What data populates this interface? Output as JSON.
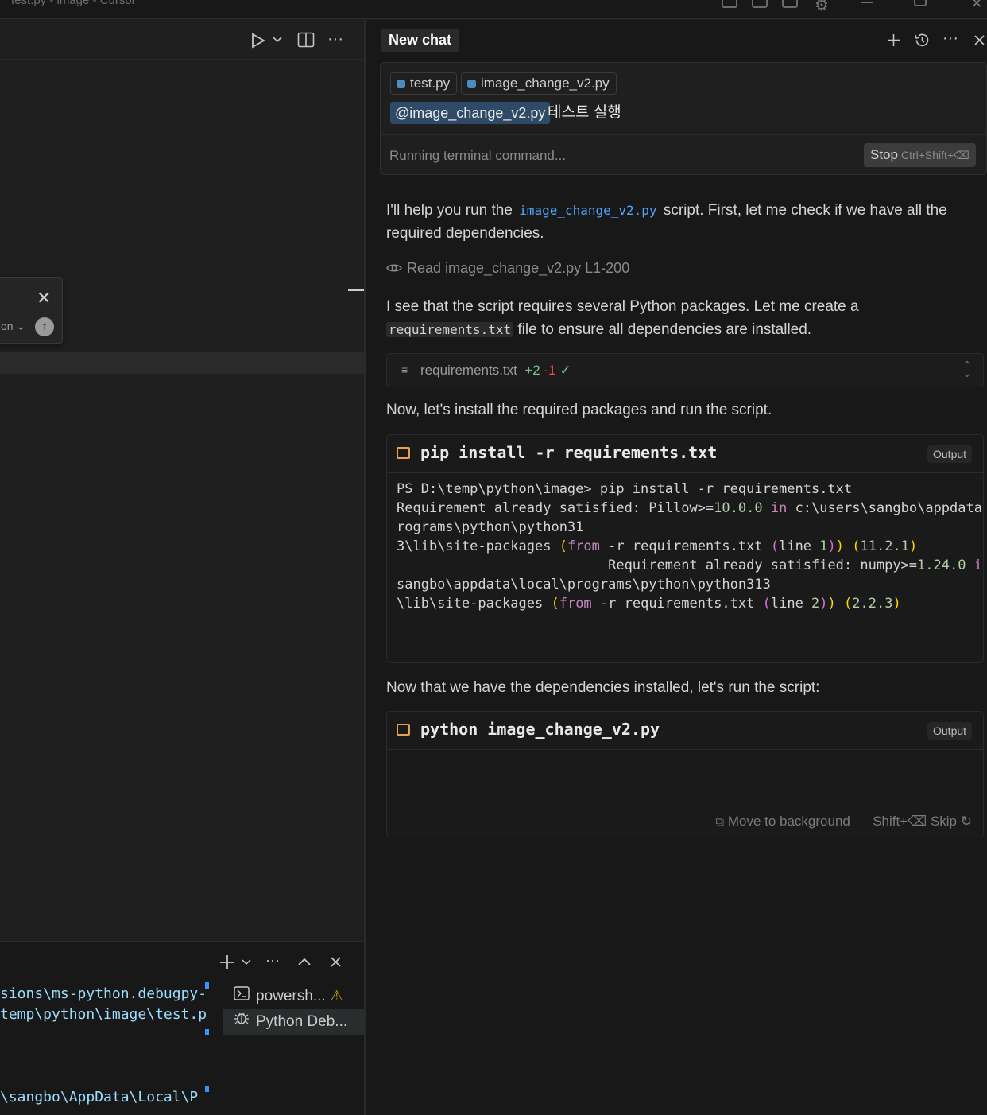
{
  "window": {
    "title": "test.py - image - Cursor"
  },
  "editor": {
    "find_option_label": "on"
  },
  "terminal": {
    "lines": [
      "sions\\ms-python.debugpy-",
      "temp\\python\\image\\test.p",
      "\\sangbo\\AppData\\Local\\P"
    ],
    "sessions": [
      {
        "label": "powersh...",
        "icon": "terminal-icon",
        "warning": true
      },
      {
        "label": "Python Deb...",
        "icon": "debug-icon",
        "warning": false
      }
    ]
  },
  "chat": {
    "tab_label": "New chat",
    "composer": {
      "chips": [
        "test.py",
        "image_change_v2.py"
      ],
      "mention": "@image_change_v2.py",
      "prompt_text": "테스트 실행",
      "status": "Running terminal command...",
      "stop_label": "Stop",
      "stop_shortcut": "Ctrl+Shift+⌫"
    },
    "messages": {
      "m1_a": "I'll help you run the ",
      "m1_code": "image_change_v2.py",
      "m1_b": " script. First, let me check if we have all the required dependencies.",
      "read_tool": "Read image_change_v2.py L1-200",
      "m2_a": "I see that the script requires several Python packages. Let me create a ",
      "m2_code": "requirements.txt",
      "m2_b": " file to ensure all dependencies are installed.",
      "diff_file": "requirements.txt",
      "diff_plus": "+2",
      "diff_minus": "-1",
      "m3": "Now, let's install the required packages and run the script.",
      "m4": "Now that we have the dependencies installed, let's run the script:"
    },
    "cmd1": {
      "command": "pip install -r requirements.txt",
      "output_label": "Output"
    },
    "cmd2": {
      "command": "python image_change_v2.py",
      "output_label": "Output",
      "background_label": "Move to background",
      "skip_shortcut": "Shift+⌫",
      "skip_label": "Skip"
    }
  },
  "colors": {
    "accent_blue": "#4fa6ff",
    "terminal_orange": "#e8a04a",
    "diff_plus": "#73c991",
    "diff_minus": "#f14c4c",
    "warning": "#cca700"
  }
}
